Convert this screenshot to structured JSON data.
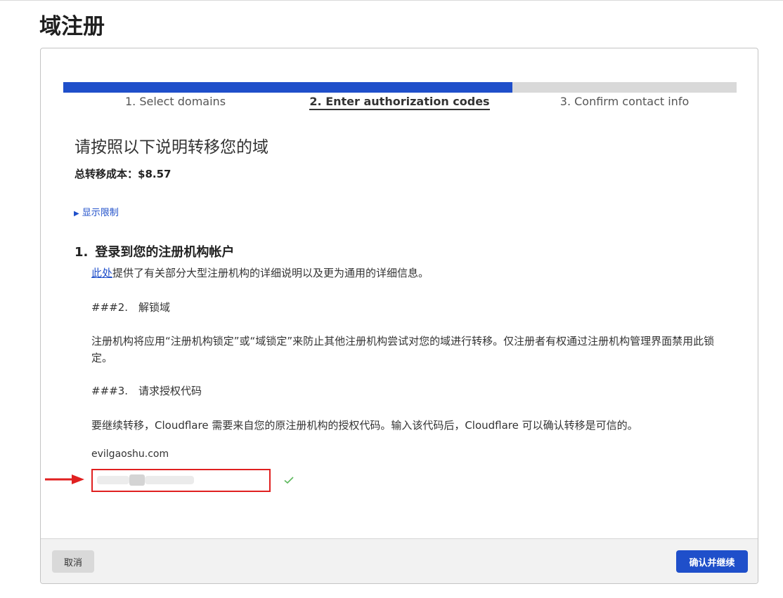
{
  "page": {
    "title": "域注册"
  },
  "wizard": {
    "progress_fraction": 0.667,
    "steps": [
      {
        "label": "1. Select domains",
        "active": false
      },
      {
        "label": "2. Enter authorization codes",
        "active": true
      },
      {
        "label": "3. Confirm contact info",
        "active": false
      }
    ]
  },
  "main": {
    "heading": "请按照以下说明转移您的域",
    "total_cost_label": "总转移成本：",
    "total_cost_value": "$8.57",
    "show_limits": "显示限制",
    "step1": {
      "number": "1.",
      "title": "登录到您的注册机构帐户",
      "link_text": "此处",
      "text": "提供了有关部分大型注册机构的详细说明以及更为通用的详细信息。"
    },
    "step2_heading": "###2.　解锁域",
    "step2_text": "注册机构将应用“注册机构锁定”或“域锁定”来防止其他注册机构尝试对您的域进行转移。仅注册者有权通过注册机构管理界面禁用此锁定。",
    "step3_heading": "###3.　请求授权代码",
    "step3_text": "要继续转移，Cloudflare 需要来自您的原注册机构的授权代码。输入该代码后，Cloudflare 可以确认转移是可信的。",
    "domain": "evilgaoshu.com",
    "auth_code_input": {
      "value": "",
      "status_icon": "check-icon"
    }
  },
  "footer": {
    "cancel_label": "取消",
    "confirm_label": "确认并继续"
  },
  "colors": {
    "accent": "#1f4fca",
    "highlight_border": "#e02020",
    "success": "#5cb85c",
    "annotation_arrow": "#e02020"
  }
}
